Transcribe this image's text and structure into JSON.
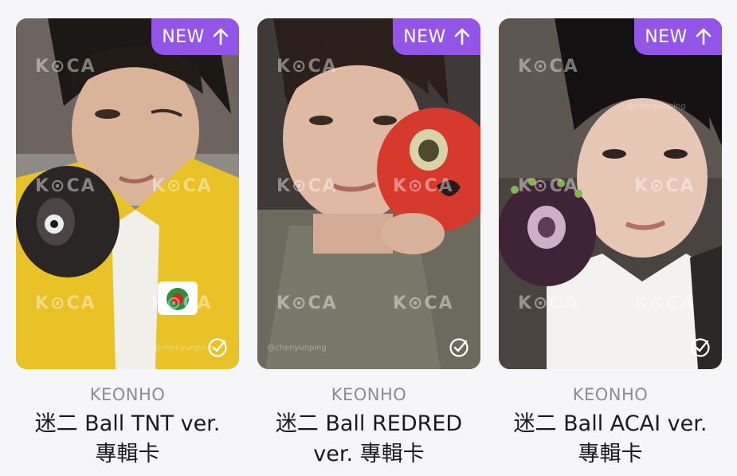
{
  "cards": [
    {
      "badge": "NEW",
      "member": "KEONHO",
      "title_line1": "迷二 Ball TNT ver.",
      "title_line2": "專輯卡",
      "watermark": "K⊙CA",
      "credit": "@chenyunping",
      "accent": "#e9c227"
    },
    {
      "badge": "NEW",
      "member": "KEONHO",
      "title_line1": "迷二 Ball REDRED",
      "title_line2": "ver. 專輯卡",
      "watermark": "K⊙CA",
      "credit": "@chenyunping",
      "accent": "#d63a2c"
    },
    {
      "badge": "NEW",
      "member": "KEONHO",
      "title_line1": "迷二 Ball ACAI ver.",
      "title_line2": "專輯卡",
      "watermark": "K⊙CA",
      "credit": "@chenyunping",
      "accent": "#4b2a45"
    }
  ],
  "colors": {
    "badge_bg": "#9255e8",
    "member_text": "#8c8c92",
    "title_text": "#1b1b1f",
    "background": "#f6f6f8"
  }
}
